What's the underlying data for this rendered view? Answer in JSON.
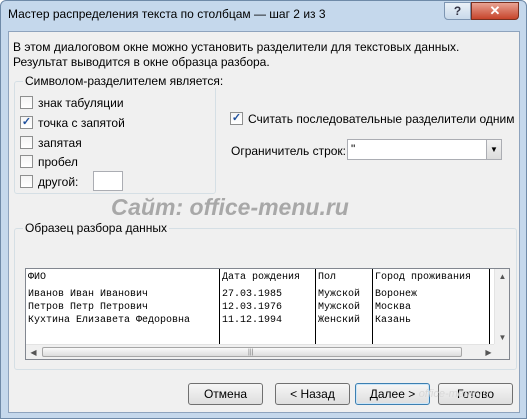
{
  "window": {
    "title": "Мастер распределения текста по столбцам — шаг 2 из 3",
    "help_icon": "?",
    "close_icon": "✕"
  },
  "description": "В этом диалоговом окне можно установить разделители для текстовых данных. Результат выводится в окне образца разбора.",
  "delimiters": {
    "group_title": "Символом-разделителем является:",
    "items": [
      {
        "label": "знак табуляции",
        "checked": false
      },
      {
        "label": "точка с запятой",
        "checked": true
      },
      {
        "label": "запятая",
        "checked": false
      },
      {
        "label": "пробел",
        "checked": false
      },
      {
        "label": "другой:",
        "checked": false
      }
    ],
    "other_value": ""
  },
  "consecutive": {
    "label": "Считать последовательные разделители одним",
    "checked": true
  },
  "text_qualifier": {
    "label": "Ограничитель строк:",
    "value": "\""
  },
  "watermark": "Сайт: office-menu.ru",
  "preview": {
    "title": "Образец разбора данных",
    "header": [
      "ФИО",
      "Дата рождения",
      "Пол",
      "Город проживания"
    ],
    "rows": [
      [
        "Иванов Иван Иванович",
        "27.03.1985",
        "Мужской",
        "Воронеж"
      ],
      [
        "Петров Петр Петрович",
        "12.03.1976",
        "Мужской",
        "Москва"
      ],
      [
        "Кухтина Елизавета Федоровна",
        "11.12.1994",
        "Женский",
        "Казань"
      ]
    ]
  },
  "buttons": {
    "cancel": "Отмена",
    "back": "< Назад",
    "next": "Далее >",
    "finish": "Готово"
  },
  "footer_watermark": "office-menu.ru"
}
